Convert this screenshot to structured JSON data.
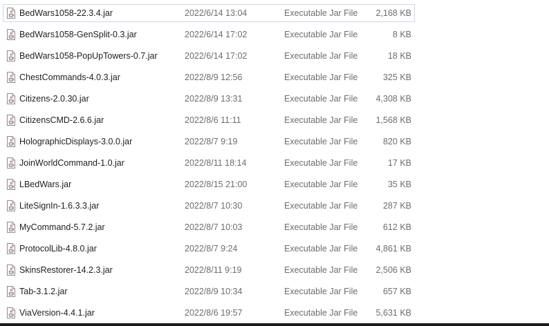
{
  "files": [
    {
      "name": "BedWars1058-22.3.4.jar",
      "date": "2022/6/14 13:04",
      "type": "Executable Jar File",
      "size": "2,168 KB",
      "selected": true,
      "icon": "jar-file-icon"
    },
    {
      "name": "BedWars1058-GenSplit-0.3.jar",
      "date": "2022/6/14 17:02",
      "type": "Executable Jar File",
      "size": "8 KB",
      "icon": "jar-file-icon"
    },
    {
      "name": "BedWars1058-PopUpTowers-0.7.jar",
      "date": "2022/6/14 17:02",
      "type": "Executable Jar File",
      "size": "18 KB",
      "icon": "jar-file-icon"
    },
    {
      "name": "ChestCommands-4.0.3.jar",
      "date": "2022/8/9 12:56",
      "type": "Executable Jar File",
      "size": "325 KB",
      "icon": "jar-file-icon"
    },
    {
      "name": "Citizens-2.0.30.jar",
      "date": "2022/8/9 13:31",
      "type": "Executable Jar File",
      "size": "4,308 KB",
      "icon": "jar-file-icon"
    },
    {
      "name": "CitizensCMD-2.6.6.jar",
      "date": "2022/8/6 11:11",
      "type": "Executable Jar File",
      "size": "1,568 KB",
      "icon": "jar-file-icon"
    },
    {
      "name": "HolographicDisplays-3.0.0.jar",
      "date": "2022/8/7 9:19",
      "type": "Executable Jar File",
      "size": "820 KB",
      "icon": "jar-file-icon"
    },
    {
      "name": "JoinWorldCommand-1.0.jar",
      "date": "2022/8/11 18:14",
      "type": "Executable Jar File",
      "size": "17 KB",
      "icon": "jar-file-icon"
    },
    {
      "name": "LBedWars.jar",
      "date": "2022/8/15 21:00",
      "type": "Executable Jar File",
      "size": "35 KB",
      "icon": "jar-file-icon"
    },
    {
      "name": "LiteSignIn-1.6.3.3.jar",
      "date": "2022/8/7 10:30",
      "type": "Executable Jar File",
      "size": "287 KB",
      "icon": "jar-file-icon"
    },
    {
      "name": "MyCommand-5.7.2.jar",
      "date": "2022/8/7 10:03",
      "type": "Executable Jar File",
      "size": "612 KB",
      "icon": "jar-file-icon"
    },
    {
      "name": "ProtocolLib-4.8.0.jar",
      "date": "2022/8/7 9:24",
      "type": "Executable Jar File",
      "size": "4,861 KB",
      "icon": "jar-file-icon"
    },
    {
      "name": "SkinsRestorer-14.2.3.jar",
      "date": "2022/8/11 9:19",
      "type": "Executable Jar File",
      "size": "2,506 KB",
      "icon": "jar-file-icon"
    },
    {
      "name": "Tab-3.1.2.jar",
      "date": "2022/8/9 10:34",
      "type": "Executable Jar File",
      "size": "657 KB",
      "icon": "jar-file-icon"
    },
    {
      "name": "ViaVersion-4.4.1.jar",
      "date": "2022/8/6 19:57",
      "type": "Executable Jar File",
      "size": "5,631 KB",
      "icon": "jar-file-icon"
    }
  ]
}
